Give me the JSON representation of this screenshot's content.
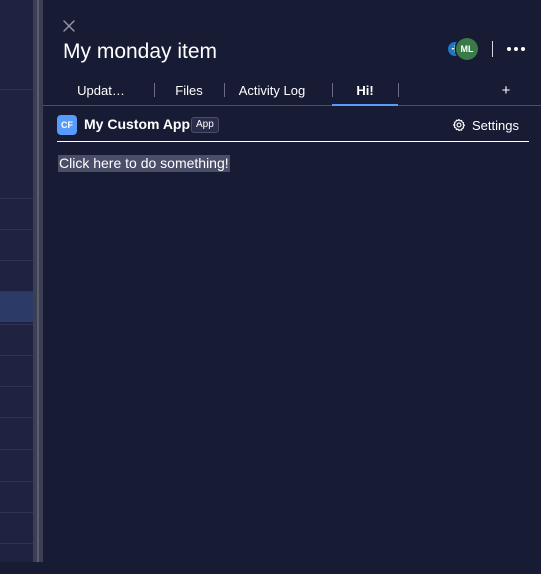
{
  "panel": {
    "title": "My monday item",
    "avatar_initials": "ML",
    "avatar_add_glyph": "+"
  },
  "tabs": [
    {
      "label": "Updat…"
    },
    {
      "label": "Files"
    },
    {
      "label": "Activity Log"
    },
    {
      "label": "Hi!"
    }
  ],
  "active_tab": "Hi!",
  "tab_add_label": "+",
  "app": {
    "icon_text": "CF",
    "name": "My Custom App",
    "badge": "App",
    "settings_label": "Settings"
  },
  "content": {
    "action_text": "Click here to do something!"
  },
  "colors": {
    "background": "#181b34",
    "accent": "#579bfc",
    "avatar": "#3a7a49"
  }
}
